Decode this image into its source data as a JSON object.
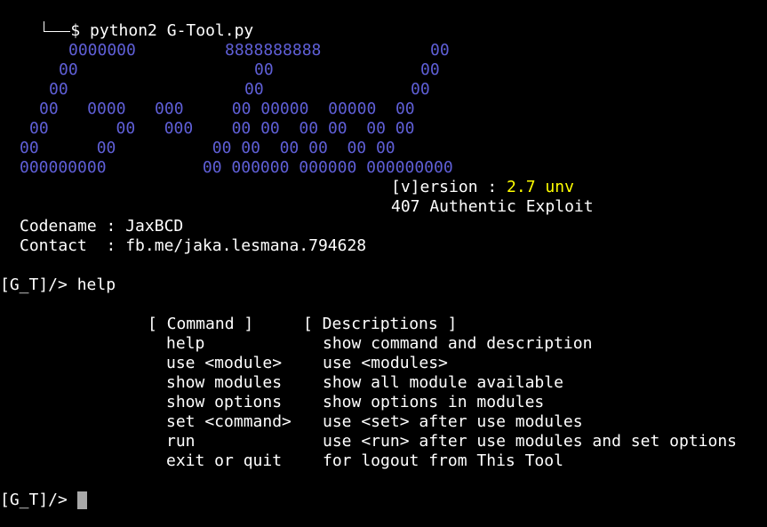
{
  "prompt_line": {
    "dollar": "$",
    "command": " python2 G-Tool.py"
  },
  "banner": {
    "art_lines": [
      "    0000000        8888888888          00",
      "   00                 00              00",
      "  00                00              00",
      " 00   0000   000     00 00000  00000  00",
      "00       00   000    00 00  00 00  00 00",
      "00      00          00 00  00 00  00 00",
      "000000000          00 000000 000000 000000000"
    ],
    "art_color": "#5f5fd7",
    "version_prefix": "[v]ersion : ",
    "version_value": "2.7 unv",
    "version_color": "#ffff00",
    "tagline": "407 Authentic Exploit"
  },
  "info": {
    "codename_label": "Codename : ",
    "codename_value": "JaxBCD",
    "contact_label": "Contact  : ",
    "contact_value": "fb.me/jaka.lesmana.794628"
  },
  "session": {
    "prompt": "[G_T]/> ",
    "entered_command": "help"
  },
  "help_table": {
    "headers": [
      "[ Command ]",
      "[ Descriptions ]"
    ],
    "rows": [
      {
        "command": "help",
        "description": "show command and description"
      },
      {
        "command": "use <module>",
        "description": "use <modules>"
      },
      {
        "command": "show modules",
        "description": "show all module available"
      },
      {
        "command": "show options",
        "description": "show options in modules"
      },
      {
        "command": "set <command>",
        "description": "use <set> after use modules"
      },
      {
        "command": "run",
        "description": "use <run> after use modules and set options"
      },
      {
        "command": "exit or quit",
        "description": "for logout from This Tool"
      }
    ]
  },
  "final_prompt": {
    "prompt": "[G_T]/> "
  },
  "colors": {
    "background": "#000000",
    "foreground": "#ffffff",
    "cursor": "#a8a8a8"
  }
}
